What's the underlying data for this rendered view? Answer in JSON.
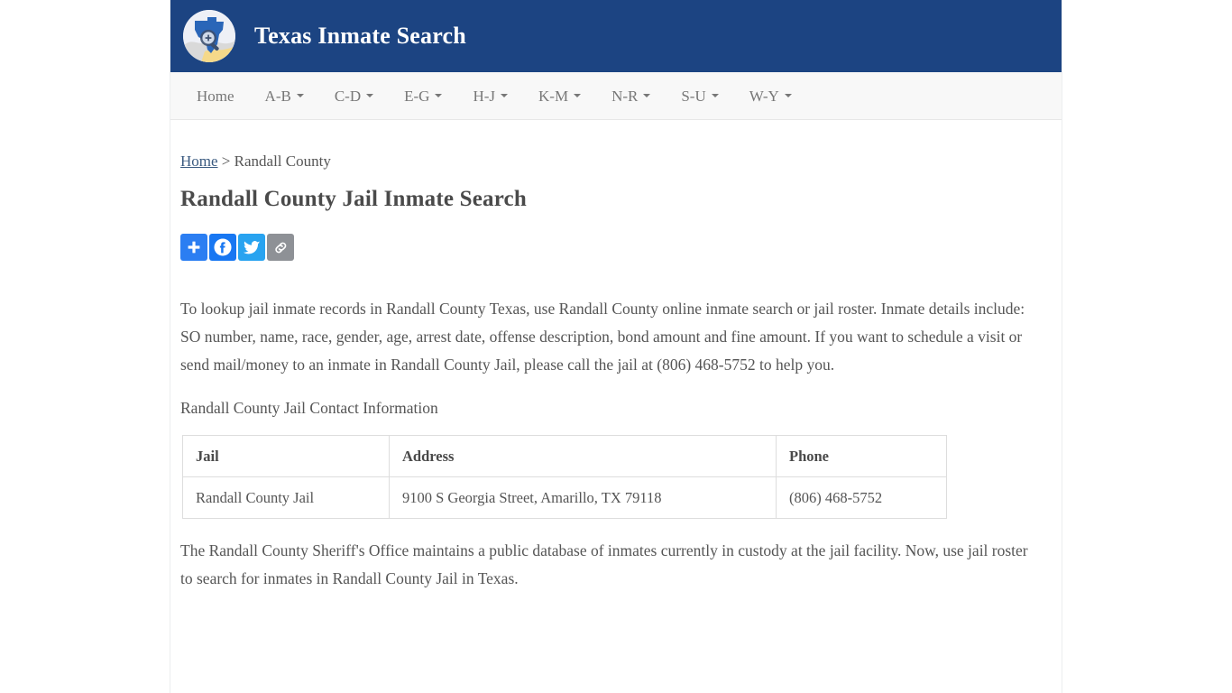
{
  "site": {
    "brand_title": "Texas Inmate Search",
    "logo_icon": "texas-magnifier-icon",
    "header_color": "#1c4482",
    "nav_background": "#f8f8f8"
  },
  "nav": {
    "items": [
      {
        "label": "Home",
        "has_dropdown": false
      },
      {
        "label": "A-B",
        "has_dropdown": true
      },
      {
        "label": "C-D",
        "has_dropdown": true
      },
      {
        "label": "E-G",
        "has_dropdown": true
      },
      {
        "label": "H-J",
        "has_dropdown": true
      },
      {
        "label": "K-M",
        "has_dropdown": true
      },
      {
        "label": "N-R",
        "has_dropdown": true
      },
      {
        "label": "S-U",
        "has_dropdown": true
      },
      {
        "label": "W-Y",
        "has_dropdown": true
      }
    ]
  },
  "breadcrumb": {
    "home_label": "Home",
    "separator": " > ",
    "current_label": "Randall County"
  },
  "main": {
    "page_title": "Randall County Jail Inmate Search",
    "intro_paragraph": "To lookup jail inmate records in Randall County Texas, use Randall County online inmate search or jail roster. Inmate details include: SO number, name, race, gender, age, arrest date, offense description, bond amount and fine amount. If you want to schedule a visit or send mail/money to an inmate in Randall County Jail, please call the jail at (806) 468-5752 to help you.",
    "contact_heading": "Randall County Jail Contact Information",
    "closing_paragraph": "The Randall County Sheriff's Office maintains a public database of inmates currently in custody at the jail facility. Now, use jail roster to search for inmates in Randall County Jail in Texas."
  },
  "share": {
    "buttons": [
      {
        "name": "addthis-share-button",
        "icon": "plus-icon",
        "color": "#2b7ef2"
      },
      {
        "name": "facebook-share-button",
        "icon": "facebook-icon",
        "color": "#1877f2"
      },
      {
        "name": "twitter-share-button",
        "icon": "twitter-icon",
        "color": "#28a3f0"
      },
      {
        "name": "copy-link-button",
        "icon": "link-icon",
        "color": "#8e9196"
      }
    ]
  },
  "contact_table": {
    "headers": [
      "Jail",
      "Address",
      "Phone"
    ],
    "rows": [
      {
        "jail": "Randall County Jail",
        "address": "9100 S Georgia Street, Amarillo, TX 79118",
        "phone": "(806) 468-5752"
      }
    ]
  }
}
